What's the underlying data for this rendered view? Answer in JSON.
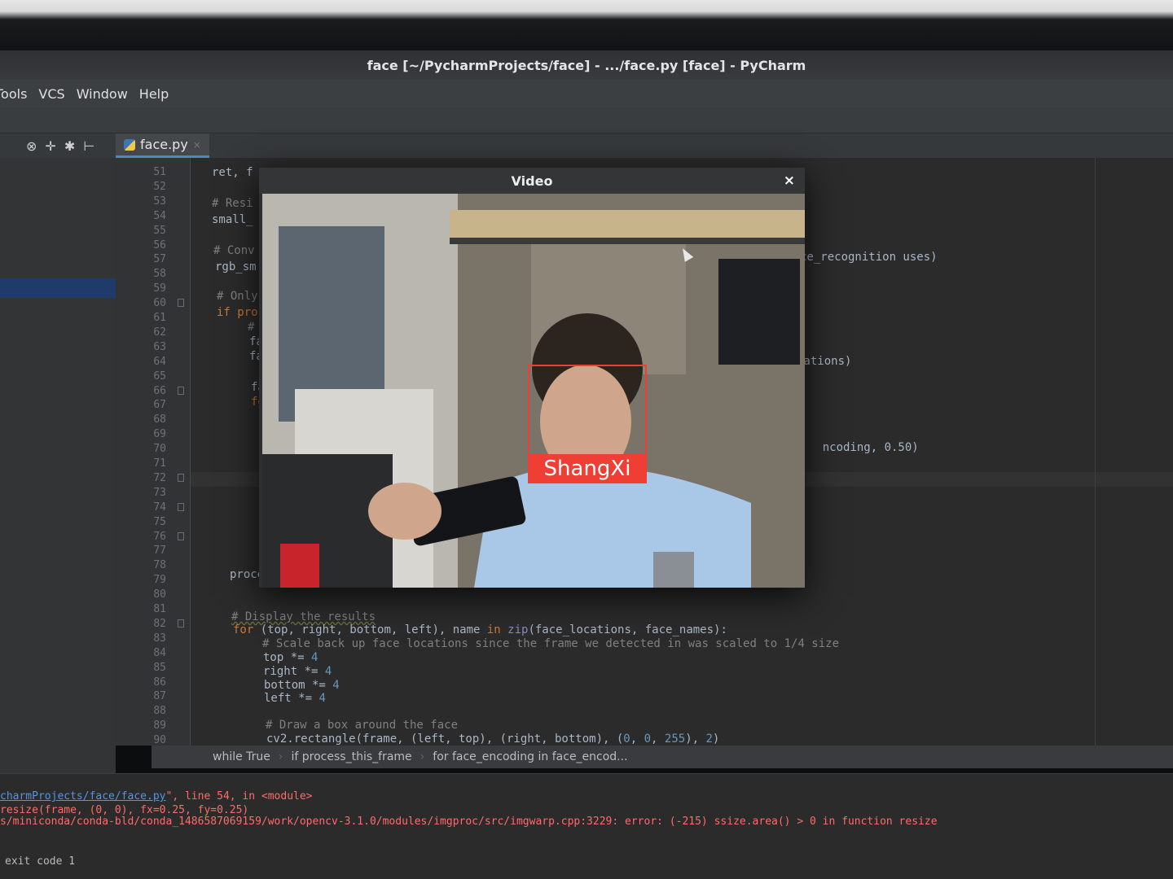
{
  "window": {
    "title": "face [~/PycharmProjects/face] - .../face.py [face] - PyCharm"
  },
  "menubar": {
    "items": [
      "Tools",
      "VCS",
      "Window",
      "Help"
    ]
  },
  "toolbar": {
    "icons": [
      "settings-circle-icon",
      "collapse-icon",
      "gear-icon",
      "pin-icon"
    ]
  },
  "editor_tab": {
    "filename": "face.py",
    "close_glyph": "×"
  },
  "gutter": {
    "line_numbers": [
      "51",
      "52",
      "53",
      "54",
      "55",
      "56",
      "57",
      "58",
      "59",
      "60",
      "61",
      "62",
      "63",
      "64",
      "65",
      "66",
      "67",
      "68",
      "69",
      "70",
      "71",
      "72",
      "73",
      "74",
      "75",
      "76",
      "77",
      "78",
      "79",
      "80",
      "81",
      "82",
      "83",
      "84",
      "85",
      "86",
      "87",
      "88",
      "89",
      "90"
    ]
  },
  "code": {
    "left_fragments": [
      "ret, f",
      "# Resi",
      "small_",
      "# Conv",
      "rgb_sm",
      "# Only",
      "if pro",
      "#",
      "fa",
      "fa",
      "fa",
      "fo",
      "proces"
    ],
    "right_fragments": [
      "ce_recognition uses)",
      "cations)",
      "ncoding, 0.50)"
    ],
    "display_comment": "# Display the results",
    "for_line_kw": "for",
    "for_line_body": " (top, right, bottom, left), name ",
    "for_line_in": "in",
    "for_line_zip": " zip",
    "for_line_args": "(face_locations, face_names):",
    "scale_comment": "# Scale back up face locations since the frame we detected in was scaled to 1/4 size",
    "top_line": "top *= ",
    "right_line": "right *= ",
    "bottom_line": "bottom *= ",
    "left_line": "left *= ",
    "scale_value": "4",
    "draw_comment": "# Draw a box around the face",
    "rectangle_line_pre": "cv2.rectangle(frame, (left, top), (right, bottom), (",
    "rect_n1": "0",
    "rect_n2": "0",
    "rect_n3": "255",
    "rect_n4": "2"
  },
  "breadcrumb": [
    "while True",
    "if process_this_frame",
    "for face_encoding in face_encod..."
  ],
  "console": {
    "line1_link": "charmProjects/face/face.py",
    "line1_rest": "\", line 54, in <module>",
    "line2": "resize(frame, (0, 0), fx=0.25, fy=0.25)",
    "line3": "s/miniconda/conda-bld/conda_1486587069159/work/opencv-3.1.0/modules/imgproc/src/imgwarp.cpp:3229: error: (-215) ssize.area() > 0 in function resize",
    "line4": "exit code 1"
  },
  "video_window": {
    "title": "Video",
    "close_glyph": "×",
    "face_label": "ShangXi"
  },
  "colors": {
    "face_box": "#ef3e34",
    "editor_bg": "#2b2b2b",
    "keyword": "#cc7832",
    "number": "#6897bb",
    "comment": "#808080"
  }
}
